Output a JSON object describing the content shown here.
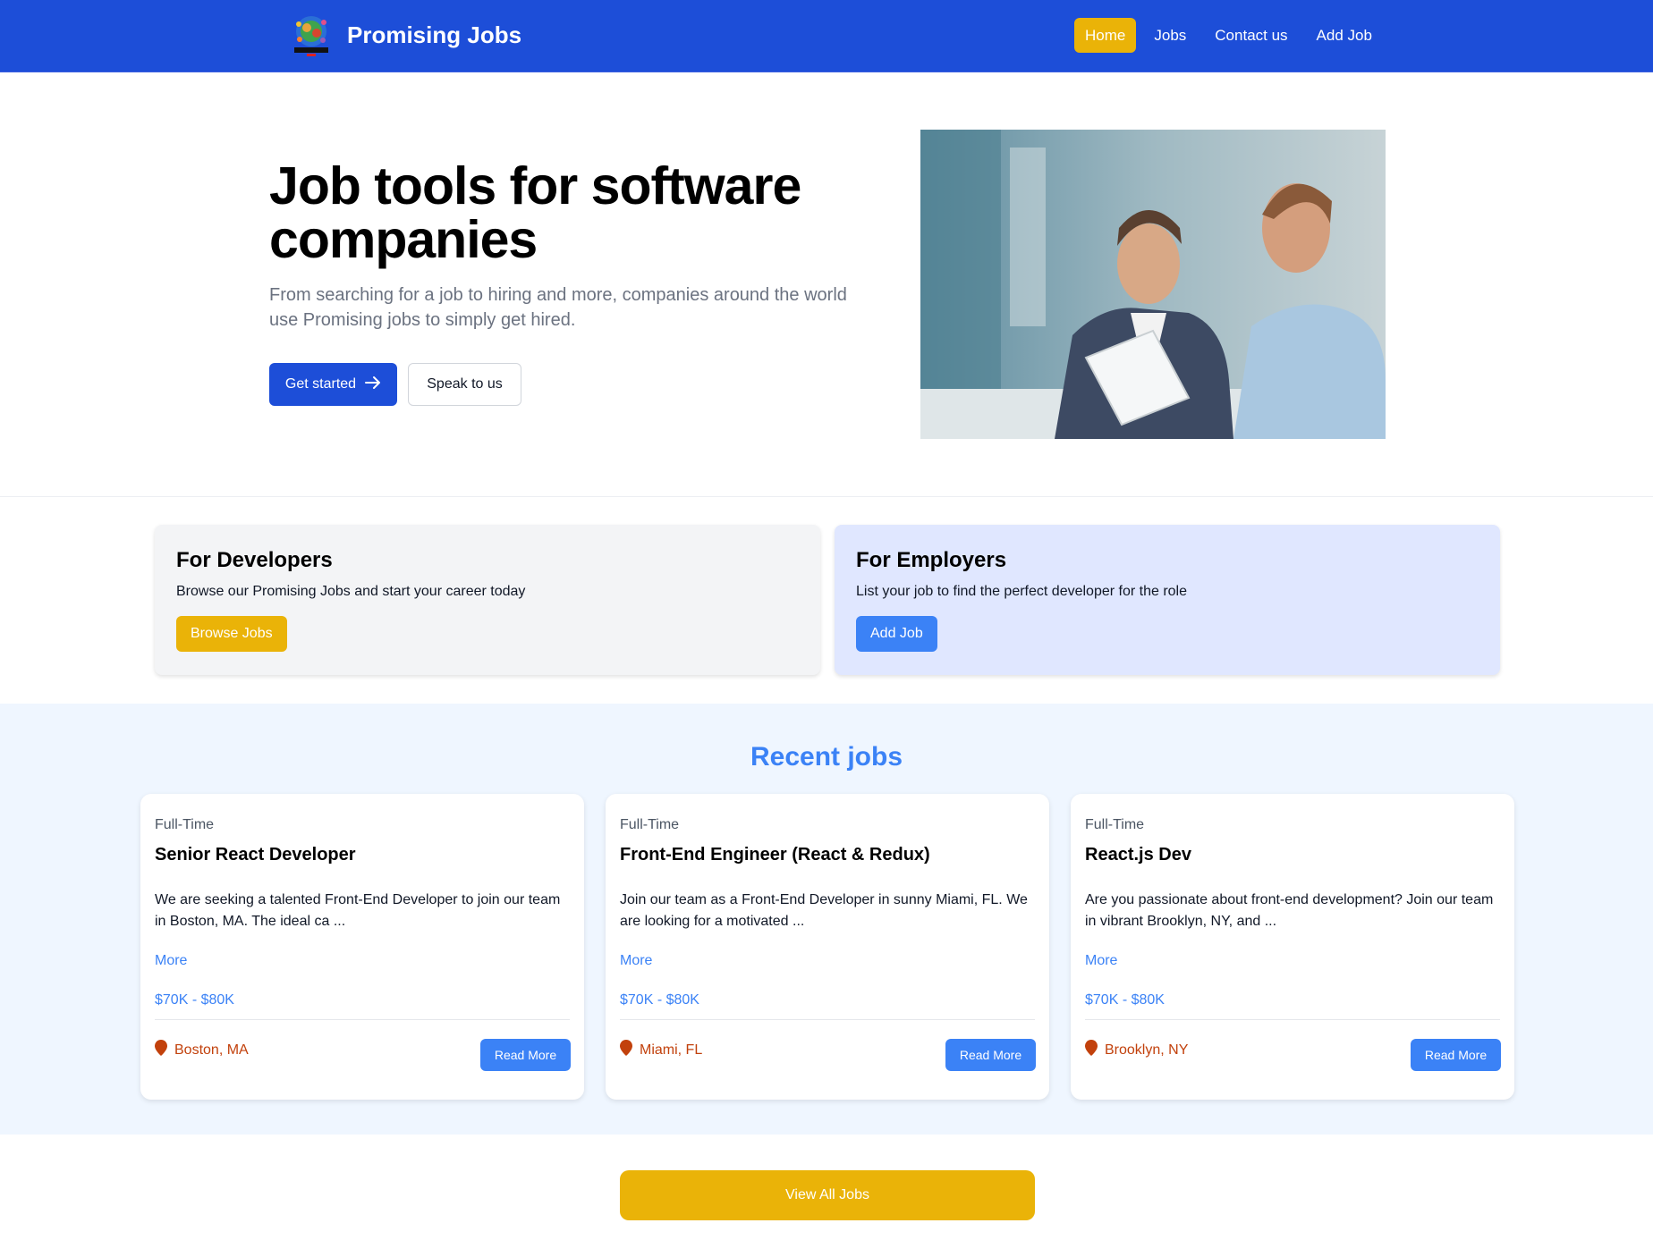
{
  "nav": {
    "brand": "Promising Jobs",
    "logo_icon": "globe-people-logo",
    "links": [
      {
        "label": "Home",
        "active": true
      },
      {
        "label": "Jobs",
        "active": false
      },
      {
        "label": "Contact us",
        "active": false
      },
      {
        "label": "Add Job",
        "active": false
      }
    ]
  },
  "hero": {
    "title": "Job tools for software companies",
    "subtitle": "From searching for a job to hiring and more, companies around the world use Promising jobs to simply get hired.",
    "primary_button": "Get started",
    "secondary_button": "Speak to us"
  },
  "cards": {
    "developers": {
      "title": "For Developers",
      "description": "Browse our Promising Jobs and start your career today",
      "button": "Browse Jobs"
    },
    "employers": {
      "title": "For Employers",
      "description": "List your job to find the perfect developer for the role",
      "button": "Add Job"
    }
  },
  "recent_jobs": {
    "heading": "Recent jobs",
    "jobs": [
      {
        "type": "Full-Time",
        "title": "Senior React Developer",
        "description": "We are seeking a talented Front-End Developer to join our team in Boston, MA. The ideal ca ...",
        "more": "More",
        "salary": "$70K - $80K",
        "location": "Boston, MA",
        "button": "Read More"
      },
      {
        "type": "Full-Time",
        "title": "Front-End Engineer (React & Redux)",
        "description": "Join our team as a Front-End Developer in sunny Miami, FL. We are looking for a motivated ...",
        "more": "More",
        "salary": "$70K - $80K",
        "location": "Miami, FL",
        "button": "Read More"
      },
      {
        "type": "Full-Time",
        "title": "React.js Dev",
        "description": "Are you passionate about front-end development? Join our team in vibrant Brooklyn, NY, and ...",
        "more": "More",
        "salary": "$70K - $80K",
        "location": "Brooklyn, NY",
        "button": "Read More"
      }
    ]
  },
  "view_all": "View All Jobs",
  "colors": {
    "nav_bg": "#1d4ed8",
    "accent_yellow": "#eab308",
    "accent_blue": "#3b82f6",
    "location_red": "#c2410c"
  }
}
